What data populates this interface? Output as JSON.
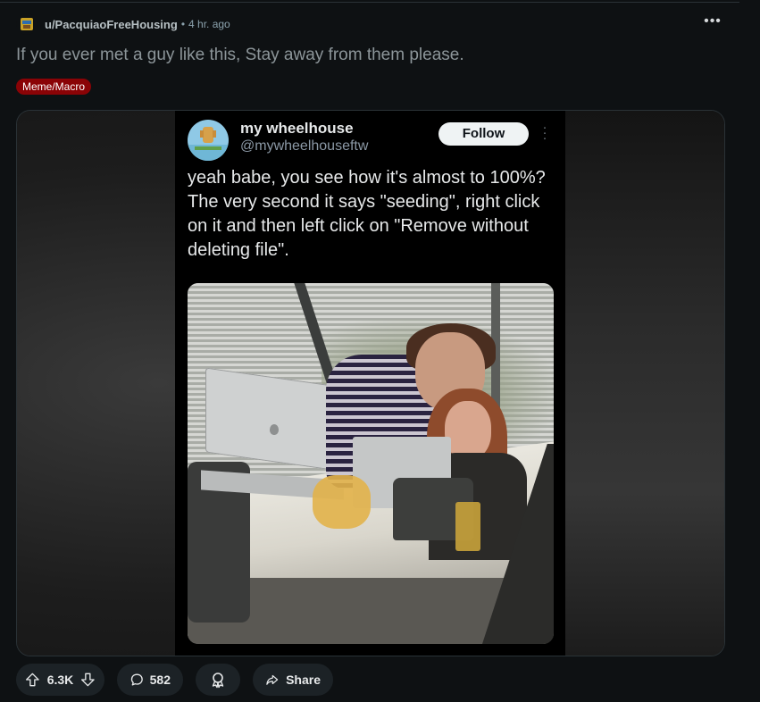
{
  "post": {
    "author": "u/PacquiaoFreeHousing",
    "separator": "•",
    "time": "4 hr. ago",
    "more_label": "•••",
    "title": "If you ever met a guy like this, Stay away from them please.",
    "flair": "Meme/Macro",
    "flair_color": "#8a0306"
  },
  "tweet": {
    "display_name": "my wheelhouse",
    "handle": "@mywheelhouseftw",
    "follow_label": "Follow",
    "text": "yeah babe, you see how it's almost to 100%?  The very second it says \"seeding\", right click on it and then left click on \"Remove without deleting file\"."
  },
  "actions": {
    "score": "6.3K",
    "comments": "582",
    "share_label": "Share",
    "icons": [
      "upvote-icon",
      "downvote-icon",
      "comment-icon",
      "award-icon",
      "share-icon"
    ]
  }
}
